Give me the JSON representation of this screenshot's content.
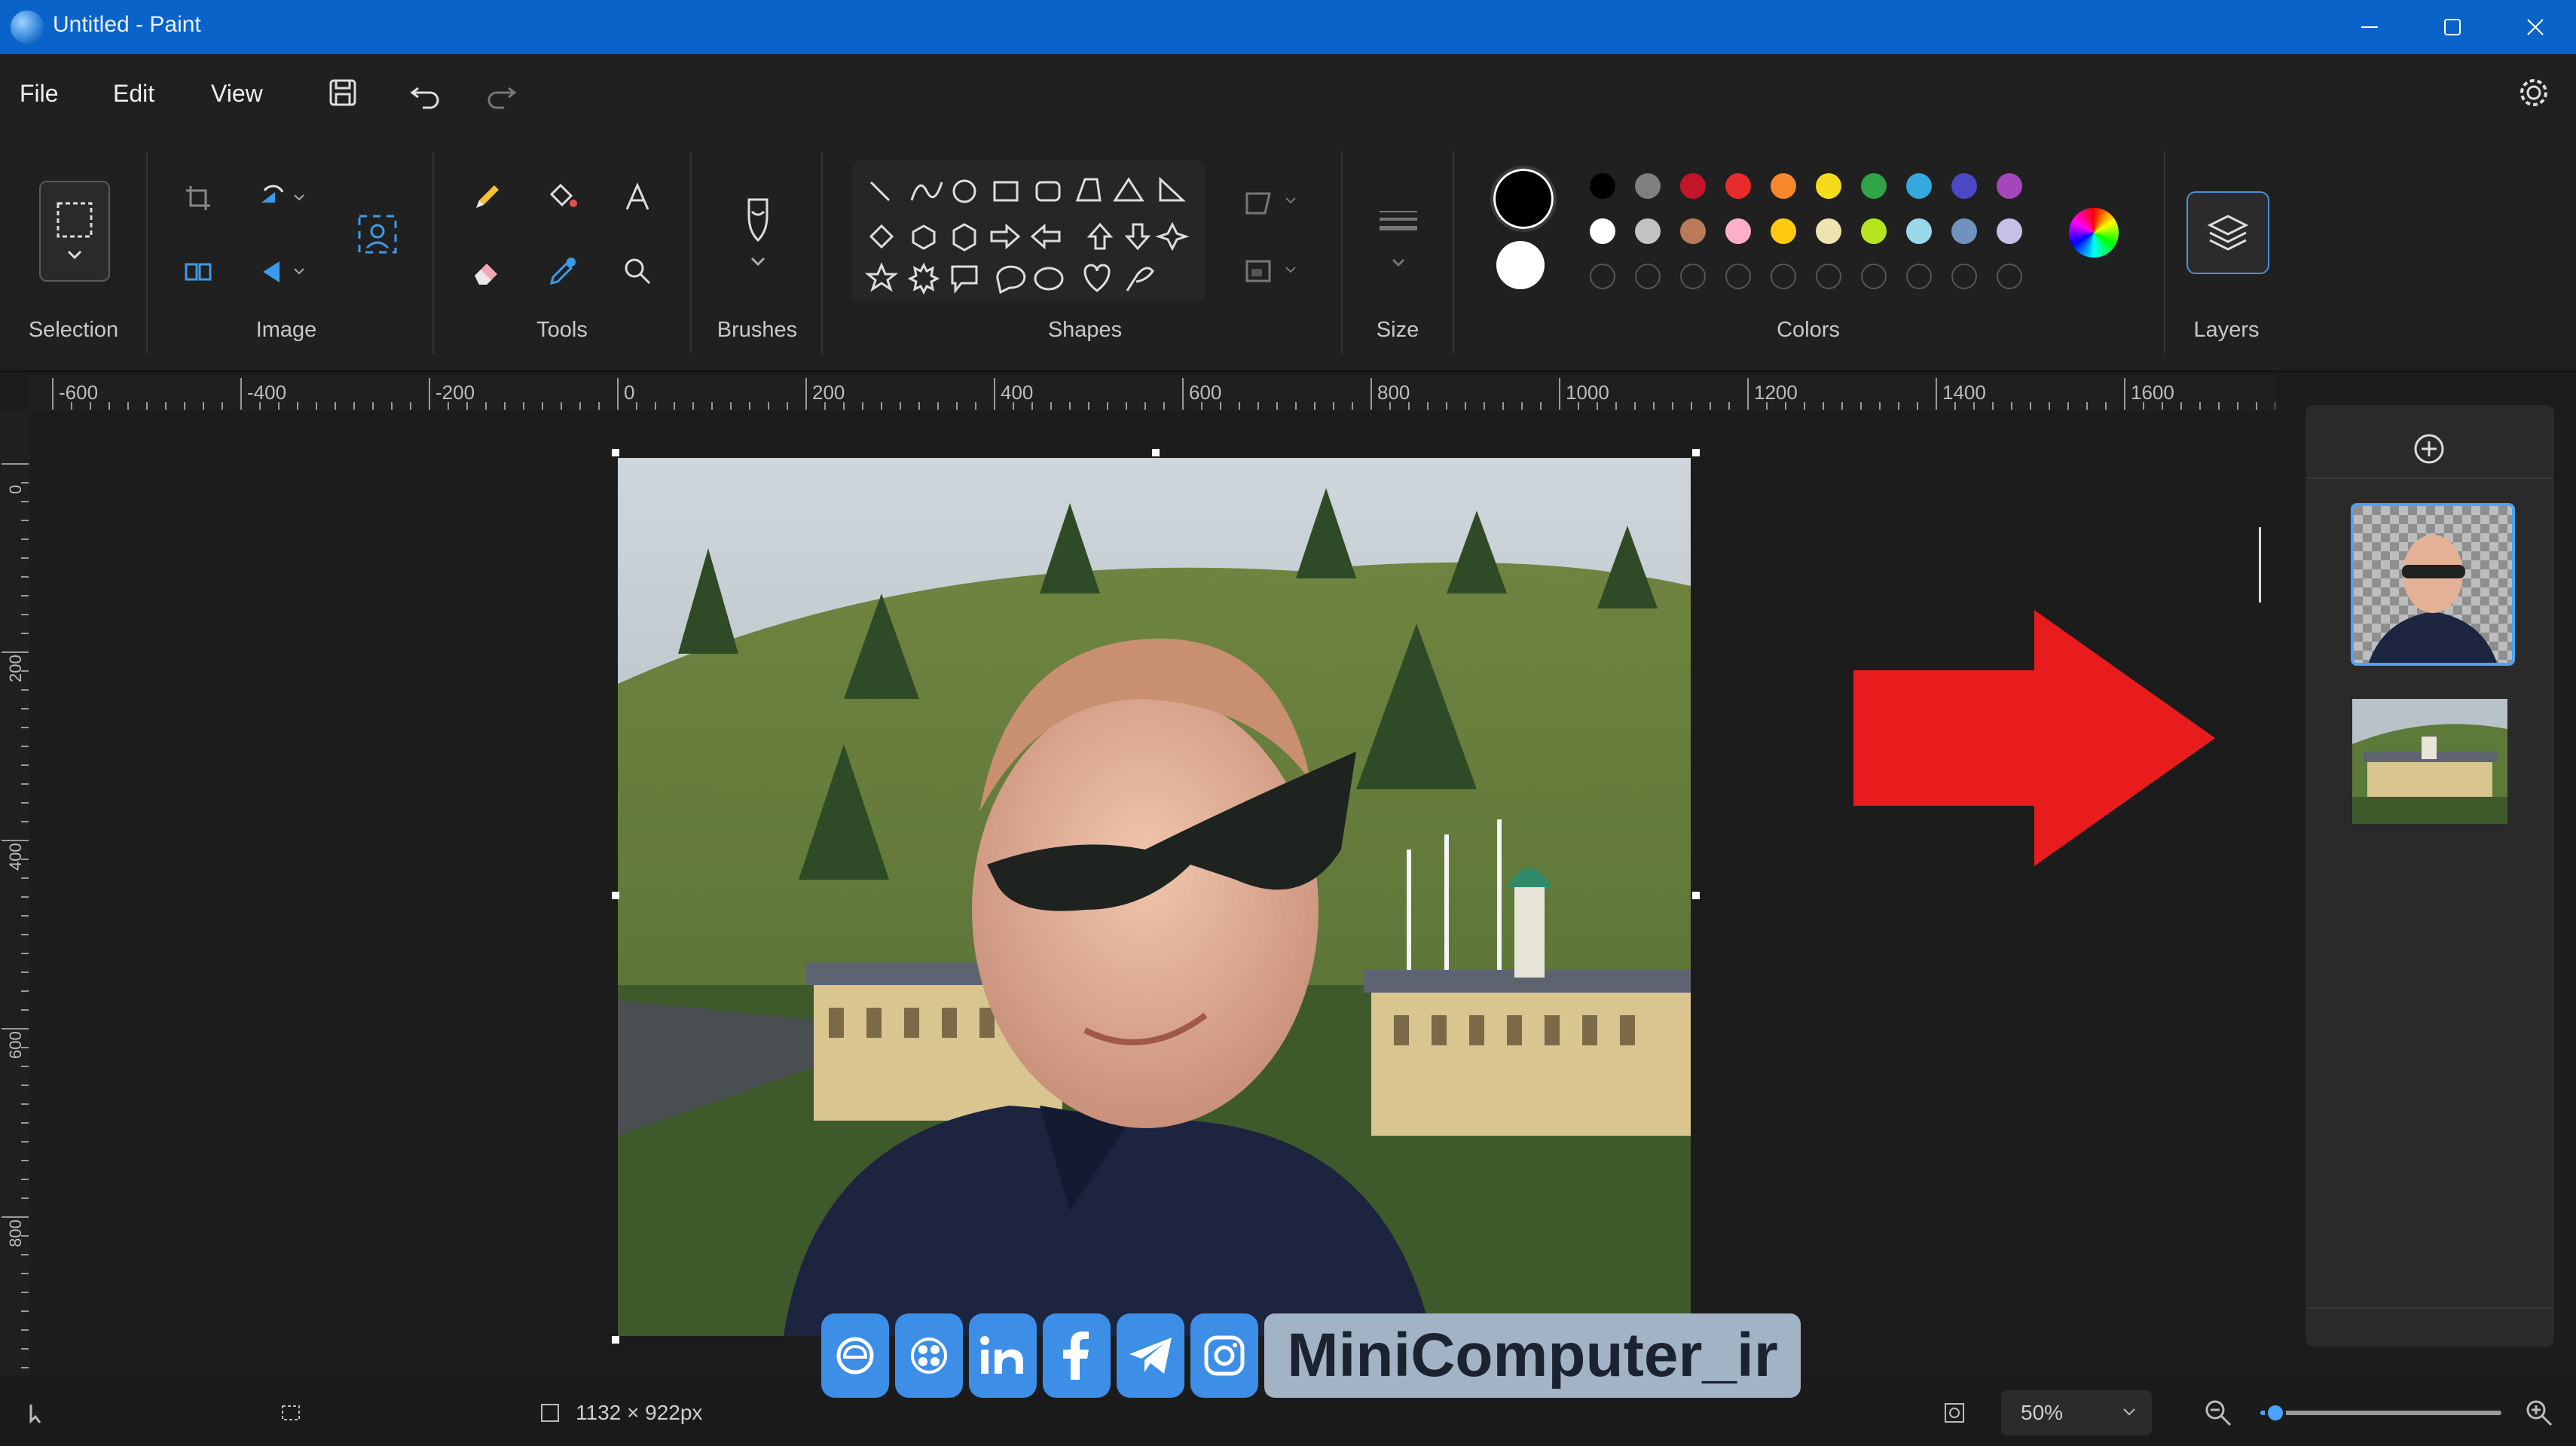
{
  "window": {
    "title": "Untitled - Paint"
  },
  "menu": {
    "file": "File",
    "edit": "Edit",
    "view": "View"
  },
  "ribbon": {
    "groups": {
      "selection": "Selection",
      "image": "Image",
      "tools": "Tools",
      "brushes": "Brushes",
      "shapes": "Shapes",
      "size": "Size",
      "colors": "Colors",
      "layers": "Layers"
    },
    "colors": {
      "primary": "#000000",
      "secondary": "#ffffff",
      "row1": [
        "#000000",
        "#7f7f7f",
        "#c3162b",
        "#e82c2c",
        "#f7872d",
        "#f5dc1b",
        "#2ea447",
        "#35a8e0",
        "#4b49c4",
        "#a347ba"
      ],
      "row2": [
        "#ffffff",
        "#c3c3c3",
        "#b97a57",
        "#ffaec9",
        "#ffc90e",
        "#efe4b0",
        "#b5e61d",
        "#99d9ea",
        "#7092be",
        "#c8bfe7"
      ]
    }
  },
  "ruler": {
    "horizontal": [
      "-600",
      "-400",
      "-200",
      "0",
      "200",
      "400",
      "600",
      "800",
      "1000",
      "1200",
      "1400",
      "1600"
    ],
    "vertical": [
      "0",
      "200",
      "400",
      "600",
      "800"
    ]
  },
  "status": {
    "canvas_size": "1132 × 922px",
    "zoom": "50%",
    "zoom_fraction": 0.03
  },
  "watermark": {
    "text": "MiniComputer_ir"
  }
}
